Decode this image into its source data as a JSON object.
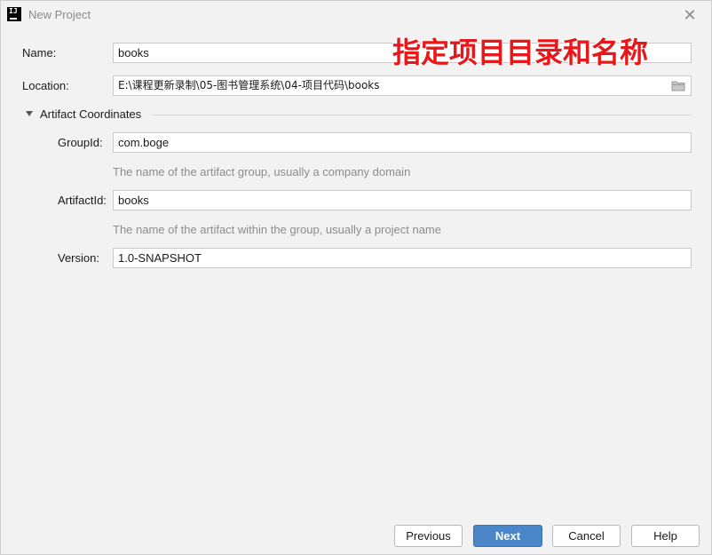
{
  "window": {
    "title": "New Project",
    "app_icon_text": "IJ"
  },
  "form": {
    "name": {
      "label": "Name:",
      "value": "books"
    },
    "location": {
      "label": "Location:",
      "value": "E:\\课程更新录制\\05-图书管理系统\\04-项目代码\\books"
    },
    "artifact_section": {
      "label": "Artifact Coordinates",
      "expanded": true
    },
    "group_id": {
      "label": "GroupId:",
      "value": "com.boge",
      "hint": "The name of the artifact group, usually a company domain"
    },
    "artifact_id": {
      "label": "ArtifactId:",
      "value": "books",
      "hint": "The name of the artifact within the group, usually a project name"
    },
    "version": {
      "label": "Version:",
      "value": "1.0-SNAPSHOT"
    }
  },
  "annotation": {
    "text": "指定项目目录和名称",
    "color": "#e8181a"
  },
  "buttons": {
    "previous": "Previous",
    "next": "Next",
    "cancel": "Cancel",
    "help": "Help"
  },
  "icons": {
    "close": "close-icon",
    "folder": "folder-icon",
    "collapse": "triangle-down-icon"
  },
  "colors": {
    "accent": "#4a86c8",
    "background": "#f2f2f2"
  }
}
